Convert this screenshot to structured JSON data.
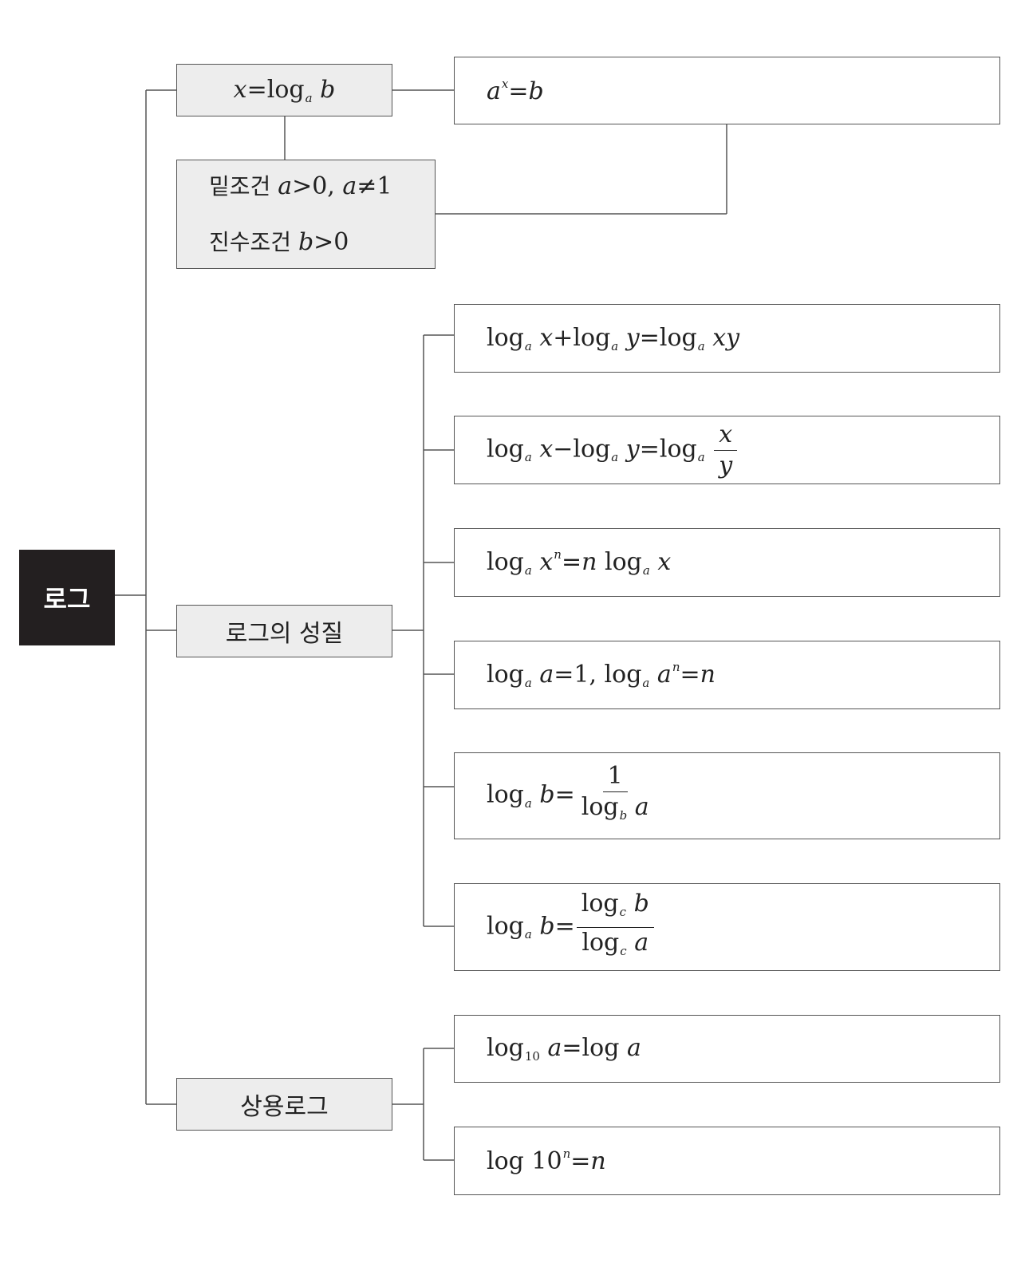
{
  "root": {
    "label": "로그"
  },
  "definition": {
    "label": "x=loga b",
    "equivalent": "ax=b",
    "conditions": {
      "base_label": "밑조건",
      "base_math": "a>0, a≠1",
      "arg_label": "진수조건",
      "arg_math": "b>0"
    }
  },
  "properties": {
    "label": "로그의 성질",
    "items": [
      "loga x+loga y=loga xy",
      "loga x−loga y=loga x/y",
      "loga xn=n loga x",
      "loga a=1, loga an=n",
      "loga b=1/logb a",
      "loga b=logc b/logc a"
    ]
  },
  "common_log": {
    "label": "상용로그",
    "items": [
      "log10 a=log a",
      "log 10n=n"
    ]
  }
}
